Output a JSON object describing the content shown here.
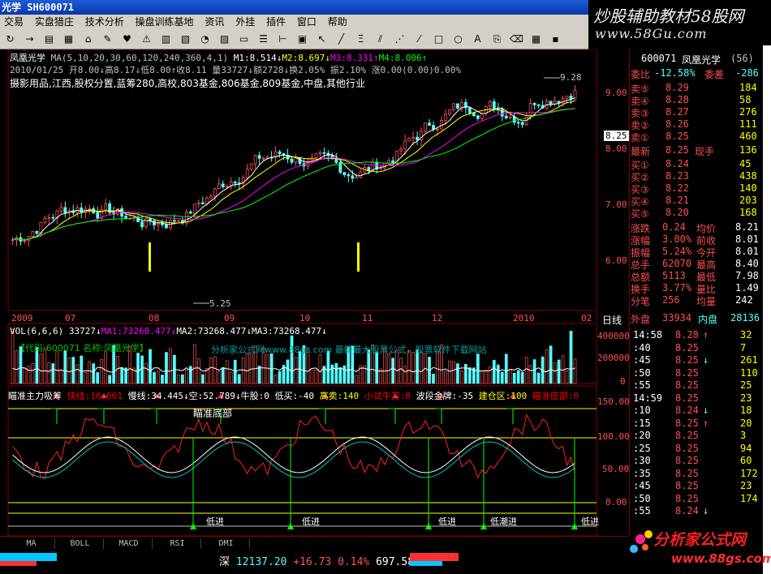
{
  "window": {
    "title": "光学  SH600071"
  },
  "banner": {
    "title": "炒股辅助教材58股网",
    "url": "www.58Gu.com"
  },
  "menu": [
    "交易",
    "实盘猎庄",
    "技术分析",
    "操盘训练基地",
    "资讯",
    "外挂",
    "插件",
    "窗口",
    "帮助"
  ],
  "toolbar_icons": [
    "refresh-icon",
    "forward-icon",
    "chart-icon",
    "grid-icon",
    "bank-icon",
    "tools-icon",
    "heart-icon",
    "alert-icon",
    "table-icon",
    "layout-icon",
    "pie-icon",
    "panel-icon",
    "window-icon",
    "list-icon",
    "ruler-icon",
    "calc-icon",
    "cursor-icon",
    "line-icon",
    "fib-icon",
    "channel-icon",
    "fan-icon",
    "parallel-icon",
    "rect-icon",
    "ellipse-icon",
    "text-icon",
    "copy-icon",
    "eraser-icon",
    "color-icon",
    "save-icon"
  ],
  "main": {
    "ma_line": "凤凰光学  MA(5,10,20,30,60,120,240,360,4,1)  M1:8.514↓M2:8.697↓M3:8.331↑M4:8.006↑",
    "ma_parts": [
      {
        "text": "凤凰光学",
        "color": "#ffffff"
      },
      {
        "text": "  MA(5,10,20,30,60,120,240,360,4,1)",
        "color": "#c0c0c0"
      },
      {
        "text": "  M1:8.514↓",
        "color": "#ffffff"
      },
      {
        "text": "M2:8.697↓",
        "color": "#ffff00"
      },
      {
        "text": "M3:8.331↑",
        "color": "#ff00ff"
      },
      {
        "text": "M4:8.006↑",
        "color": "#00ff00"
      }
    ],
    "quote_line": "2010/01/25 开8.00↓高8.17↓低8.00↑收8.11 量33727↓额2728↓换2.05% 振2.10% 涨0.00(0.00)0.00%",
    "industry_line": "摄影用品,江西,股权分置,蓝筹280,高校,803基金,806基金,809基金,中盘,其他行业",
    "high_label": "9.28",
    "low_label": "5.25",
    "price_axis": [
      "9.00",
      "8.00",
      "7.00",
      "6.00"
    ],
    "current_price_tag": "8.25",
    "time_axis": [
      "2009",
      "07",
      "08",
      "09",
      "10",
      "11",
      "12",
      "2010",
      "02"
    ],
    "period_label": "日线"
  },
  "volume": {
    "header_parts": [
      {
        "text": "VOL(6,6,6) 33727↓",
        "color": "#ffffff"
      },
      {
        "text": "MA1:73268.477↓",
        "color": "#ff00ff"
      },
      {
        "text": "MA2:73268.477↓",
        "color": "#ffffff"
      },
      {
        "text": "MA3:73268.477↓",
        "color": "#ffffff"
      }
    ],
    "info": "【代码:600071 名称:凤凰光学】",
    "watermark": "分析家公式网www.88gs.com 最新最大股票公式，股票软件下载网站",
    "axis": [
      "400000",
      "200000",
      "0"
    ]
  },
  "indicator": {
    "header_parts": [
      {
        "text": "瞄准主力吸筹 ",
        "color": "#ffffff"
      },
      {
        "text": "快线:16.661 ",
        "color": "#ff0000"
      },
      {
        "text": "慢线:34.445↓",
        "color": "#ffffff"
      },
      {
        "text": "空:52.789↓",
        "color": "#ffffff"
      },
      {
        "text": "牛股:0 ",
        "color": "#ffffff"
      },
      {
        "text": "低买:-40 ",
        "color": "#ffffff"
      },
      {
        "text": "高卖:140 ",
        "color": "#ffff00"
      },
      {
        "text": "小试牛刀:0 ",
        "color": "#ff0000"
      },
      {
        "text": "波段金牌:-35 ",
        "color": "#ffffff"
      },
      {
        "text": "建仓区:100 ",
        "color": "#ffff00"
      },
      {
        "text": "瞄准底部:0",
        "color": "#ff0000"
      }
    ],
    "bottom_label": "瞄准底部",
    "axis": [
      "150.00",
      "100.00",
      "50.00",
      "0.00"
    ],
    "signals": [
      "低进",
      "低进",
      "低进",
      "低潮进",
      "低进"
    ]
  },
  "tabs": [
    "MA",
    "BOLL",
    "MACD",
    "RSI",
    "DMI"
  ],
  "status": {
    "index_name": "深",
    "index_value": "12137.20",
    "change": "+16.73",
    "pct": "0.14%",
    "amount": "697.58亿"
  },
  "quote": {
    "code": "600071",
    "name": "凤凰光学",
    "num": "(56)",
    "commission_ratio_label": "委比",
    "commission_ratio": "-12.58%",
    "commission_diff_label": "委差",
    "commission_diff": "-286",
    "sells": [
      {
        "label": "卖⑤",
        "price": "8.29",
        "vol": "184"
      },
      {
        "label": "卖④",
        "price": "8.28",
        "vol": "58"
      },
      {
        "label": "卖③",
        "price": "8.27",
        "vol": "276"
      },
      {
        "label": "卖②",
        "price": "8.26",
        "vol": "111"
      },
      {
        "label": "卖①",
        "price": "8.25",
        "vol": "460"
      }
    ],
    "latest_label": "最新",
    "latest": "8.25",
    "hand_label": "现手",
    "hand": "136",
    "buys": [
      {
        "label": "买①",
        "price": "8.24",
        "vol": "45"
      },
      {
        "label": "买②",
        "price": "8.23",
        "vol": "438"
      },
      {
        "label": "买③",
        "price": "8.22",
        "vol": "140"
      },
      {
        "label": "买④",
        "price": "8.21",
        "vol": "203"
      },
      {
        "label": "买⑤",
        "price": "8.20",
        "vol": "168"
      }
    ],
    "stats": [
      {
        "l1": "涨跌",
        "v1": "0.24",
        "l2": "均价",
        "v2": "8.21"
      },
      {
        "l1": "涨幅",
        "v1": "3.00%",
        "l2": "前收",
        "v2": "8.01"
      },
      {
        "l1": "振幅",
        "v1": "5.24%",
        "l2": "今开",
        "v2": "8.01"
      },
      {
        "l1": "总手",
        "v1": "62070",
        "l2": "最高",
        "v2": "8.40"
      },
      {
        "l1": "总额",
        "v1": "5113",
        "l2": "最低",
        "v2": "7.98"
      },
      {
        "l1": "换手",
        "v1": "3.77%",
        "l2": "量比",
        "v2": "1.49"
      },
      {
        "l1": "分笔",
        "v1": "256",
        "l2": "均量",
        "v2": "242"
      }
    ],
    "outer_label": "外盘",
    "outer": "33934",
    "inner_label": "内盘",
    "inner": "28136",
    "ticks": [
      {
        "t": "14:58",
        "p": "8.28",
        "a": "↑",
        "v": "32"
      },
      {
        "t": ":40",
        "p": "8.25",
        "a": "",
        "v": "7"
      },
      {
        "t": ":45",
        "p": "8.25",
        "a": "↓",
        "v": "261"
      },
      {
        "t": ":50",
        "p": "8.25",
        "a": "",
        "v": "110"
      },
      {
        "t": ":55",
        "p": "8.25",
        "a": "",
        "v": "25"
      },
      {
        "t": "14:59",
        "p": "8.25",
        "a": "",
        "v": "23"
      },
      {
        "t": ":10",
        "p": "8.24",
        "a": "↓",
        "v": "18"
      },
      {
        "t": ":15",
        "p": "8.25",
        "a": "↑",
        "v": "20"
      },
      {
        "t": ":20",
        "p": "8.25",
        "a": "",
        "v": "3"
      },
      {
        "t": ":25",
        "p": "8.25",
        "a": "",
        "v": "94"
      },
      {
        "t": ":30",
        "p": "8.25",
        "a": "",
        "v": "60"
      },
      {
        "t": ":35",
        "p": "8.25",
        "a": "",
        "v": "172"
      },
      {
        "t": ":45",
        "p": "8.25",
        "a": "",
        "v": "23"
      },
      {
        "t": ":50",
        "p": "8.25",
        "a": "",
        "v": "174"
      },
      {
        "t": ":55",
        "p": "8.24",
        "a": "↓",
        "v": ""
      }
    ]
  },
  "logo": {
    "text": "分析家公式网",
    "url": "www.88gs.com"
  },
  "colors": {
    "up": "#ff5050",
    "down": "#54ffff",
    "panel_border": "#800000",
    "text_gray": "#c0c0c0"
  }
}
